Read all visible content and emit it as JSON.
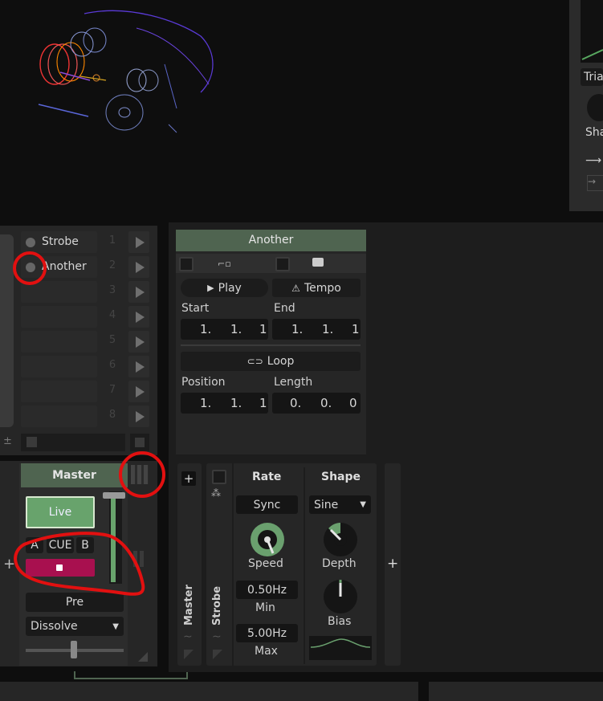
{
  "cue_list": {
    "items": [
      {
        "label": "Strobe",
        "num": "1"
      },
      {
        "label": "Another",
        "num": "2"
      },
      {
        "label": "",
        "num": "3"
      },
      {
        "label": "",
        "num": "4"
      },
      {
        "label": "",
        "num": "5"
      },
      {
        "label": "",
        "num": "6"
      },
      {
        "label": "",
        "num": "7"
      },
      {
        "label": "",
        "num": "8"
      }
    ],
    "plus_minus": "±"
  },
  "top_right": {
    "trigger_label": "Tria",
    "shape_label": "Sha"
  },
  "clip": {
    "title": "Another",
    "play_label": "Play",
    "tempo_label": "Tempo",
    "start_label": "Start",
    "end_label": "End",
    "start": [
      "1.",
      "1.",
      "1"
    ],
    "end": [
      "1.",
      "1.",
      "1"
    ],
    "loop_label": "Loop",
    "position_label": "Position",
    "length_label": "Length",
    "position": [
      "1.",
      "1.",
      "1"
    ],
    "length": [
      "0.",
      "0.",
      "0"
    ]
  },
  "master": {
    "title": "Master",
    "live_label": "Live",
    "a_label": "A",
    "cue_label": "CUE",
    "b_label": "B",
    "pre_label": "Pre",
    "transition": "Dissolve",
    "plus": "+",
    "fader_level": 0.97
  },
  "effect": {
    "track_label": "Master",
    "device_label": "Strobe",
    "rate_title": "Rate",
    "shape_title": "Shape",
    "sync_label": "Sync",
    "shape_value": "Sine",
    "speed_label": "Speed",
    "depth_label": "Depth",
    "bias_label": "Bias",
    "min_value": "0.50Hz",
    "min_label": "Min",
    "max_value": "5.00Hz",
    "max_label": "Max",
    "add_left": "+",
    "add_right": "+"
  },
  "colors": {
    "accent_green": "#6a9a6e",
    "magenta": "#a8104f",
    "annotation_red": "#e21010"
  }
}
